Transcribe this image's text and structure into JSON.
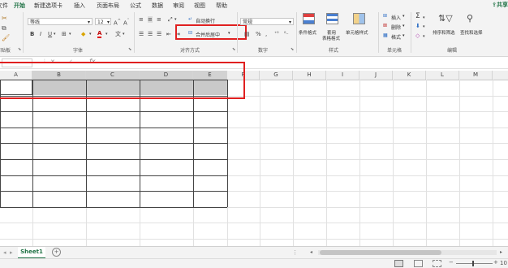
{
  "tabs": [
    "文件",
    "开始",
    "新建选项卡",
    "插入",
    "页面布局",
    "公式",
    "数据",
    "审阅",
    "视图",
    "帮助"
  ],
  "share_label": "共享",
  "ribbon": {
    "font_name": "等线",
    "font_size": "12",
    "number_format": "常规",
    "wrap_text": "自动换行",
    "merge_center": "合并后居中",
    "cond_format": "条件格式",
    "table_format_1": "套用",
    "table_format_2": "表格格式",
    "cell_styles": "单元格样式",
    "insert": "插入",
    "delete": "删除",
    "format": "格式",
    "sort_filter": "排序和筛选",
    "find_select": "查找和选择",
    "groups": {
      "clipboard": "剪贴板",
      "font": "字体",
      "alignment": "对齐方式",
      "number": "数字",
      "styles": "样式",
      "cells": "单元格",
      "editing": "编辑"
    }
  },
  "formula_bar": {
    "fx": "fx",
    "value": ""
  },
  "columns": [
    "A",
    "B",
    "C",
    "D",
    "E",
    "F",
    "G",
    "H",
    "I",
    "J",
    "K",
    "L",
    "M"
  ],
  "sheet_tab": "Sheet1",
  "zoom_text": "10",
  "colors": {
    "accent": "#217346",
    "highlight": "#e02020",
    "selected_header": "#d2d2d2",
    "table_border": "#444444"
  }
}
